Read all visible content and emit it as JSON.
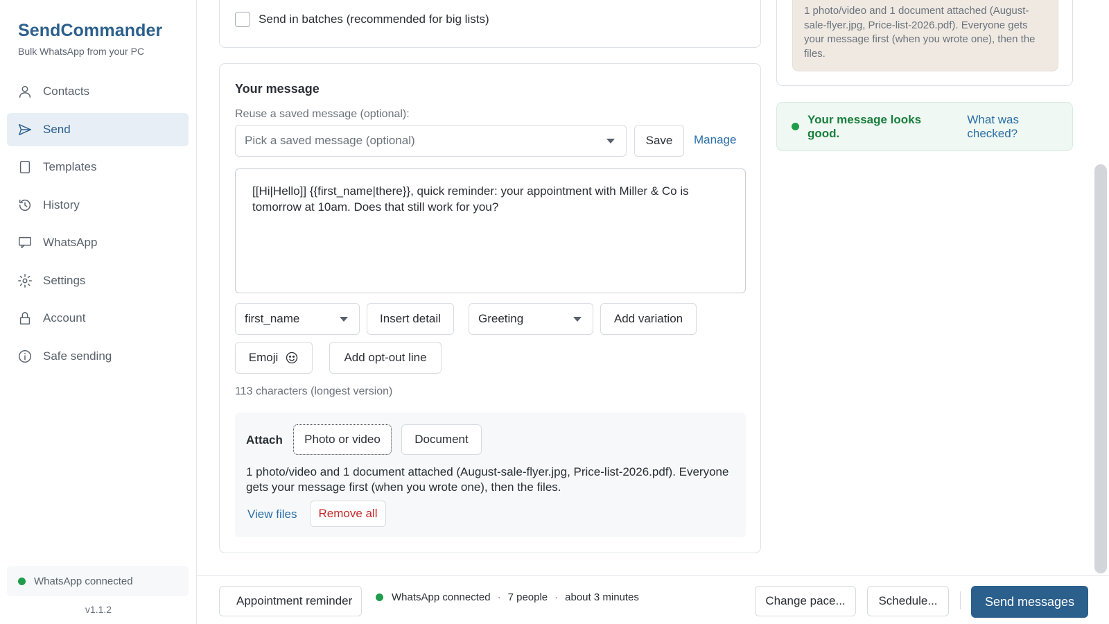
{
  "app": {
    "name": "SendCommander",
    "tagline": "Bulk WhatsApp from your PC",
    "version": "v1.1.2",
    "accent_color": "#2b5f8c"
  },
  "sidebar": {
    "items": [
      {
        "label": "Contacts",
        "icon": "person-icon"
      },
      {
        "label": "Send",
        "icon": "send-icon",
        "active": true
      },
      {
        "label": "Templates",
        "icon": "document-icon"
      },
      {
        "label": "History",
        "icon": "history-icon"
      },
      {
        "label": "WhatsApp",
        "icon": "chat-icon"
      },
      {
        "label": "Settings",
        "icon": "gear-icon"
      },
      {
        "label": "Account",
        "icon": "lock-icon"
      },
      {
        "label": "Safe sending",
        "icon": "info-icon"
      }
    ],
    "status": "WhatsApp connected",
    "status_color": "#1f9d4c"
  },
  "batch": {
    "checkbox_label": "Send in batches (recommended for big lists)",
    "checked": false
  },
  "message": {
    "title": "Your message",
    "reuse_label": "Reuse a saved message (optional):",
    "saved_select_placeholder": "Pick a saved message (optional)",
    "save_label": "Save",
    "manage_label": "Manage",
    "body": "[[Hi|Hello]] {{first_name|there}}, quick reminder: your appointment with Miller & Co is tomorrow at 10am. Does that still work for you?",
    "detail_select": "first_name",
    "insert_detail_label": "Insert detail",
    "variation_select": "Greeting",
    "add_variation_label": "Add variation",
    "emoji_label": "Emoji",
    "opt_out_label": "Add opt-out line",
    "char_count": "113 characters (longest version)"
  },
  "attach": {
    "label": "Attach",
    "photo_label": "Photo or video",
    "document_label": "Document",
    "summary": "1 photo/video and 1 document attached (August-sale-flyer.jpg, Price-list-2026.pdf). Everyone gets your message first (when you wrote one), then the files.",
    "view_files_label": "View files",
    "remove_all_label": "Remove all"
  },
  "preview": {
    "note": "1 photo/video and 1 document attached (August-sale-flyer.jpg, Price-list-2026.pdf). Everyone gets your message first (when you wrote one), then the files."
  },
  "check": {
    "message": "Your message looks good.",
    "link": "What was checked?",
    "color": "#1a7f3f"
  },
  "bottom": {
    "template_button": "Appointment reminder",
    "status": "WhatsApp connected",
    "people": "7 people",
    "duration": "about 3 minutes",
    "change_pace_label": "Change pace...",
    "schedule_label": "Schedule...",
    "send_label": "Send messages"
  }
}
